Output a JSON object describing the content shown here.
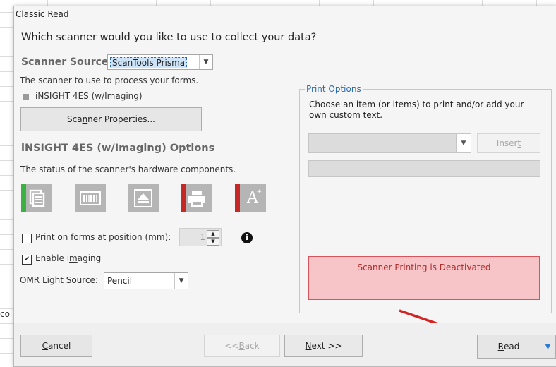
{
  "background": {
    "cell_text": "co"
  },
  "dialog": {
    "title": "Classic Read",
    "question": "Which scanner would you like to use to collect your data?",
    "scanner_source": {
      "label": "Scanner Source:",
      "selected": "ScanTools Prisma",
      "description": "The scanner to use to process your forms.",
      "device": "iNSIGHT 4ES (w/Imaging)",
      "properties_button": {
        "before": "Sca",
        "underlined": "n",
        "after": "ner Properties..."
      }
    },
    "options": {
      "heading": "iNSIGHT 4ES (w/Imaging) Options",
      "status_text": "The status of the scanner's hardware components.",
      "hardware": [
        {
          "name": "feeder",
          "status": "green"
        },
        {
          "name": "barcode",
          "status": "none"
        },
        {
          "name": "eject",
          "status": "none"
        },
        {
          "name": "printer",
          "status": "red"
        },
        {
          "name": "font",
          "status": "red"
        }
      ],
      "print_position": {
        "checked": false,
        "underlined": "P",
        "rest": "rint on forms at position (mm):",
        "value": "1"
      },
      "enable_imaging": {
        "checked": true,
        "before": "Enable i",
        "underlined": "m",
        "after": "aging"
      },
      "omr": {
        "underlined": "O",
        "rest": "MR Light Source:",
        "selected": "Pencil"
      }
    },
    "print_options": {
      "legend": "Print Options",
      "description": "Choose an item (or items) to print and/or add your own custom text.",
      "insert_button": {
        "before": "Inser",
        "underlined": "t"
      },
      "warning": "Scanner Printing is Deactivated"
    },
    "footer": {
      "cancel": {
        "underlined": "C",
        "rest": "ancel"
      },
      "back": {
        "before": "<< ",
        "underlined": "B",
        "after": "ack"
      },
      "next": {
        "underlined": "N",
        "rest": "ext >>"
      },
      "read": {
        "underlined": "R",
        "rest": "ead"
      }
    }
  },
  "colors": {
    "accent_red": "#d32424",
    "status_green": "#3cb043",
    "status_red": "#c62828",
    "link_blue": "#2b6cb0",
    "warning_bg": "#f7c4c7"
  }
}
